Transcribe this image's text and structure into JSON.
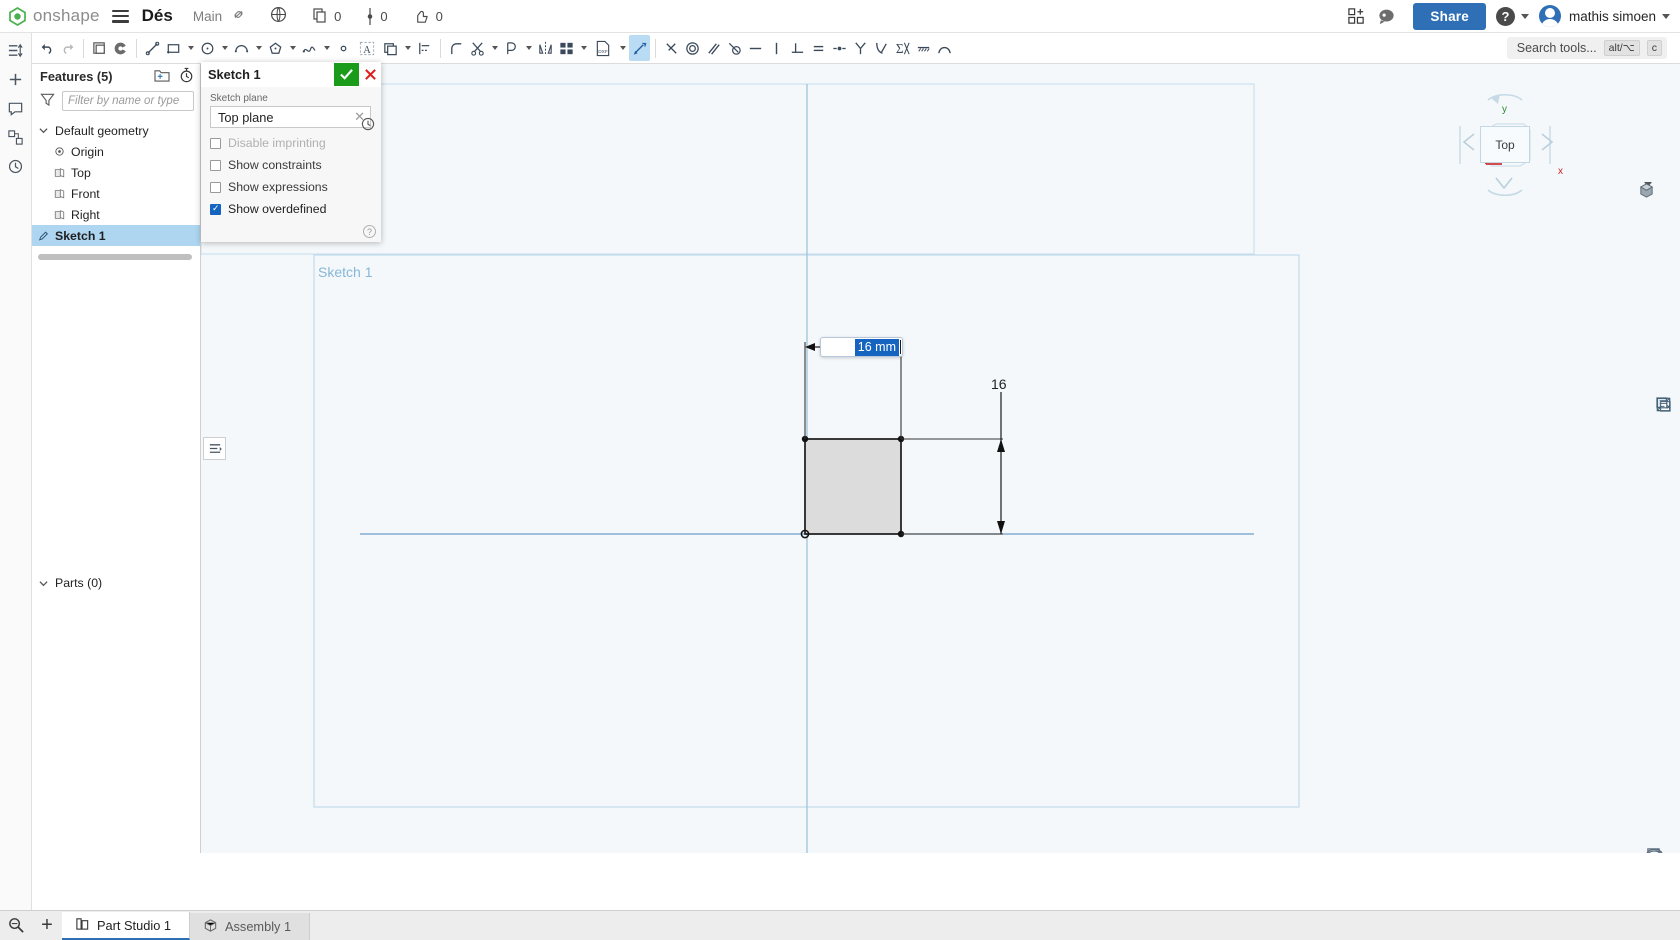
{
  "topbar": {
    "logo_text": "onshape",
    "menu_icon": "hamburger-icon",
    "document_title": "Dés",
    "branch": "Main",
    "link_icon": "link-icon",
    "globe_icon": "globe-icon",
    "counters": [
      {
        "icon": "copy-icon",
        "value": "0"
      },
      {
        "icon": "version-icon",
        "value": "0"
      },
      {
        "icon": "thumbs-up-icon",
        "value": "0"
      }
    ],
    "apps_icon": "apps-grid-plus-icon",
    "comment_icon": "comment-bubble-icon",
    "share_label": "Share",
    "help_label": "?",
    "username": "mathis simoen"
  },
  "toolbar": {
    "undo": "undo-icon",
    "redo": "redo-icon",
    "items": [
      "sketch-plane-icon",
      "color-wheel-icon",
      "line-icon",
      "rectangle-icon",
      "circle-icon",
      "arc-icon",
      "polygon-icon",
      "spline-icon",
      "point-icon",
      "text-icon",
      "offset-icon",
      "transform-icon",
      "fillet-icon",
      "trim-icon",
      "extend-icon",
      "mirror-icon",
      "linear-pattern-icon",
      "dxf-import-icon",
      "dimension-icon",
      "coincident-icon",
      "concentric-icon",
      "parallel-icon",
      "tangent-icon",
      "horizontal-icon",
      "vertical-icon",
      "perpendicular-icon",
      "equal-icon",
      "midpoint-icon",
      "symmetric-icon",
      "curvature-icon",
      "constraint-sigma-icon",
      "fix-icon",
      "normal-icon"
    ],
    "active_tool": "dimension-icon",
    "search_placeholder": "Search tools...",
    "shortcut_alt": "alt/⌥",
    "shortcut_key": "c"
  },
  "rail": {
    "items": [
      "feature-list-icon",
      "insert-feature-icon",
      "comments-icon",
      "assembly-icon",
      "history-icon"
    ],
    "bottom": "render-icon"
  },
  "features_panel": {
    "title": "Features (5)",
    "add_folder_icon": "add-folder-icon",
    "rollback_icon": "stopwatch-icon",
    "filter_icon": "funnel-icon",
    "filter_placeholder": "Filter by name or type",
    "tree": [
      {
        "label": "Default geometry",
        "icon": "chevron-down-icon",
        "level": 0,
        "selected": false
      },
      {
        "label": "Origin",
        "icon": "origin-icon",
        "level": 1,
        "selected": false
      },
      {
        "label": "Top",
        "icon": "plane-icon",
        "level": 1,
        "selected": false
      },
      {
        "label": "Front",
        "icon": "plane-icon",
        "level": 1,
        "selected": false
      },
      {
        "label": "Right",
        "icon": "plane-icon",
        "level": 1,
        "selected": false
      },
      {
        "label": "Sketch 1",
        "icon": "sketch-icon",
        "level": 0,
        "selected": true
      }
    ],
    "parts_label": "Parts (0)",
    "parts_icon": "chevron-down-icon"
  },
  "sketch_dialog": {
    "title": "Sketch 1",
    "ok_icon": "check-icon",
    "cancel_icon": "x-icon",
    "clock_icon": "history-clock-icon",
    "plane_label": "Sketch plane",
    "plane_value": "Top plane",
    "clear_icon": "clear-x-icon",
    "options": [
      {
        "label": "Disable imprinting",
        "checked": false,
        "disabled": true
      },
      {
        "label": "Show constraints",
        "checked": false,
        "disabled": false
      },
      {
        "label": "Show expressions",
        "checked": false,
        "disabled": false
      },
      {
        "label": "Show overdefined",
        "checked": true,
        "disabled": false
      }
    ],
    "help_icon": "help-icon"
  },
  "canvas": {
    "sketch_label": "Sketch 1",
    "dimension_input_value": "16 mm",
    "vertical_dimension_label": "16",
    "panel_toggle_icon": "list-panel-icon",
    "viewcube": {
      "face_label": "Top",
      "axis_y": "y",
      "axis_x": "x",
      "display_mode_icon": "shaded-cube-icon"
    },
    "right_tools": [
      "section-view-icon",
      "display-state-icon",
      "appearance-icon",
      "explode-icon"
    ],
    "bottom_icons": [
      "measure-icon",
      "units-icon",
      "settings-icon"
    ]
  },
  "tabbar": {
    "search_icon": "tab-search-icon",
    "add_icon": "+",
    "tabs": [
      {
        "label": "Part Studio 1",
        "icon": "part-studio-icon",
        "active": true
      },
      {
        "label": "Assembly 1",
        "icon": "assembly-cube-icon",
        "active": false
      }
    ]
  },
  "colors": {
    "accent": "#2f6fb5",
    "selection": "#aed6f1",
    "ok_green": "#1a9c1a",
    "cancel_red": "#e02020",
    "canvas_bg": "#f4f8fb"
  }
}
